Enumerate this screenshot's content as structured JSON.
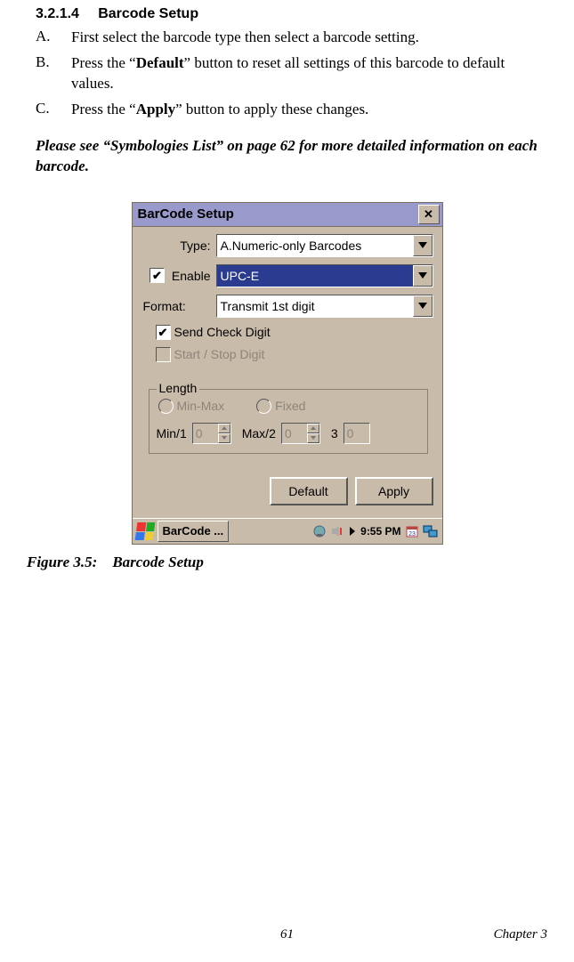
{
  "heading": {
    "number": "3.2.1.4",
    "title": "Barcode Setup"
  },
  "list": {
    "a": {
      "letter": "A.",
      "text_pre": "First select the barcode type then select a barcode setting."
    },
    "b": {
      "letter": "B.",
      "text_pre": "Press the “",
      "bold": "Default",
      "text_post": "” button to reset all settings of this barcode to default values."
    },
    "c": {
      "letter": "C.",
      "text_pre": "Press the “",
      "bold": "Apply",
      "text_post": "” button to apply these changes."
    }
  },
  "note": "Please see “Symbologies List” on page 62 for more detailed information on each barcode.",
  "ui": {
    "title": "BarCode Setup",
    "close": "✕",
    "labels": {
      "type": "Type:",
      "enable": "Enable",
      "format": "Format:"
    },
    "type_value": "A.Numeric-only Barcodes",
    "enable_value": "UPC-E",
    "enable_checked": true,
    "format_value": "Transmit 1st digit",
    "send_check": {
      "label": "Send Check Digit",
      "checked": true
    },
    "start_stop": {
      "label": "Start / Stop Digit",
      "checked": false
    },
    "group": {
      "title": "Length",
      "minmax": "Min-Max",
      "fixed": "Fixed",
      "min_label": "Min/1",
      "min_value": "0",
      "max_label": "Max/2",
      "max_value": "0",
      "three_label": "3",
      "three_value": "0"
    },
    "buttons": {
      "default": "Default",
      "apply": "Apply"
    },
    "taskbar": {
      "app": "BarCode ...",
      "time": "9:55 PM"
    }
  },
  "caption": {
    "prefix": "Figure 3.5:",
    "text": "Barcode Setup"
  },
  "footer": {
    "page": "61",
    "chapter": "Chapter 3"
  }
}
